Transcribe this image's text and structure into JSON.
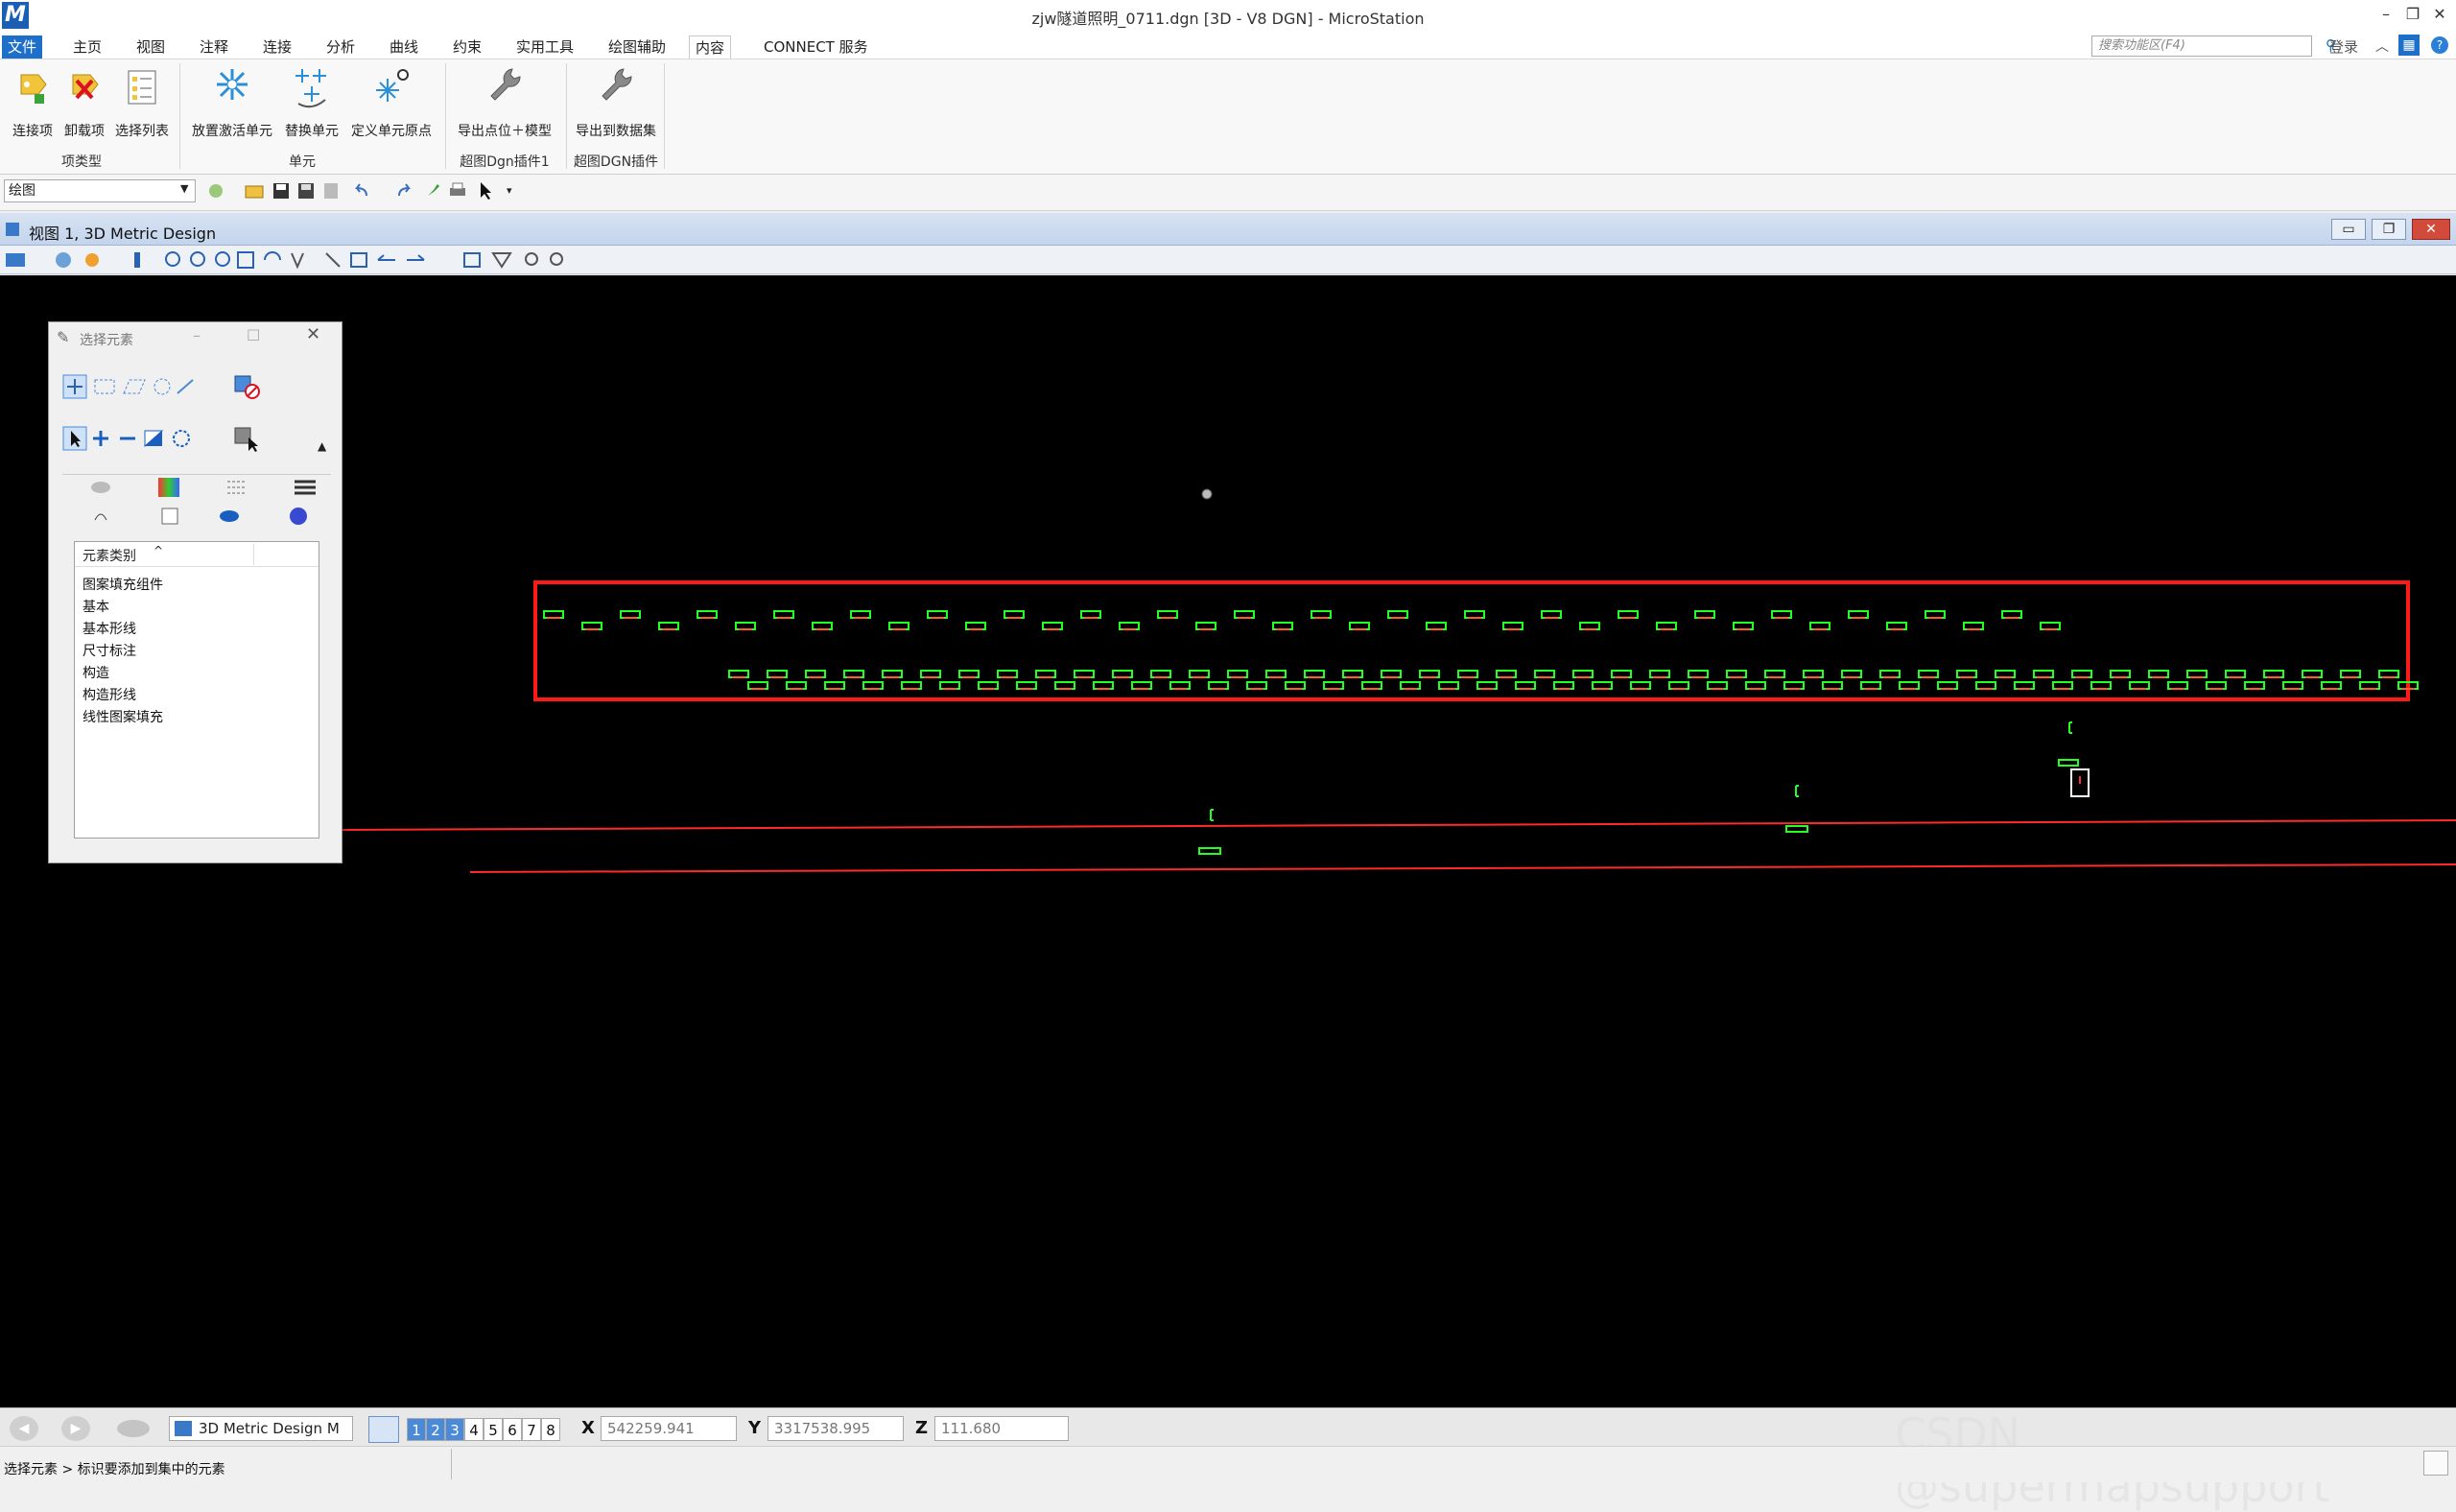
{
  "window": {
    "title": "zjw隧道照明_0711.dgn [3D - V8 DGN] - MicroStation",
    "logo": "M",
    "controls": [
      "–",
      "❐",
      "✕"
    ]
  },
  "menu": {
    "tabs": [
      "文件",
      "主页",
      "视图",
      "注释",
      "连接",
      "分析",
      "曲线",
      "约束",
      "实用工具",
      "绘图辅助",
      "内容",
      "CONNECT 服务"
    ],
    "search_placeholder": "搜索功能区(F4)",
    "login": "登录"
  },
  "ribbon": {
    "buttons": [
      "连接项",
      "卸载项",
      "选择列表",
      "放置激活单元",
      "替换单元",
      "定义单元原点",
      "导出点位＋模型",
      "导出到数据集"
    ],
    "groups": [
      "项类型",
      "单元",
      "超图Dgn插件1",
      "超图DGN插件"
    ]
  },
  "toolbar": {
    "workflow": "绘图"
  },
  "view": {
    "title": "视图 1, 3D Metric Design"
  },
  "dialog": {
    "title": "选择元素",
    "column_header": "元素类别",
    "categories": [
      "图案填充组件",
      "基本",
      "基本形线",
      "尺寸标注",
      "构造",
      "构造形线",
      "线性图案填充"
    ]
  },
  "bottom": {
    "model_combo": "3D Metric Design M",
    "view_numbers": [
      "1",
      "2",
      "3",
      "4",
      "5",
      "6",
      "7",
      "8"
    ],
    "x_label": "X",
    "x_value": "542259.941",
    "y_label": "Y",
    "y_value": "3317538.995",
    "z_label": "Z",
    "z_value": "111.680"
  },
  "status": {
    "prompt": "选择元素 > 标识要添加到集中的元素"
  },
  "watermark": "CSDN @supermapsupport",
  "colors": {
    "accent": "#1d6fc9",
    "highlight_box": "#ff2020",
    "element_green": "#00ff00",
    "element_red": "#ff3030",
    "canvas": "#000000"
  }
}
